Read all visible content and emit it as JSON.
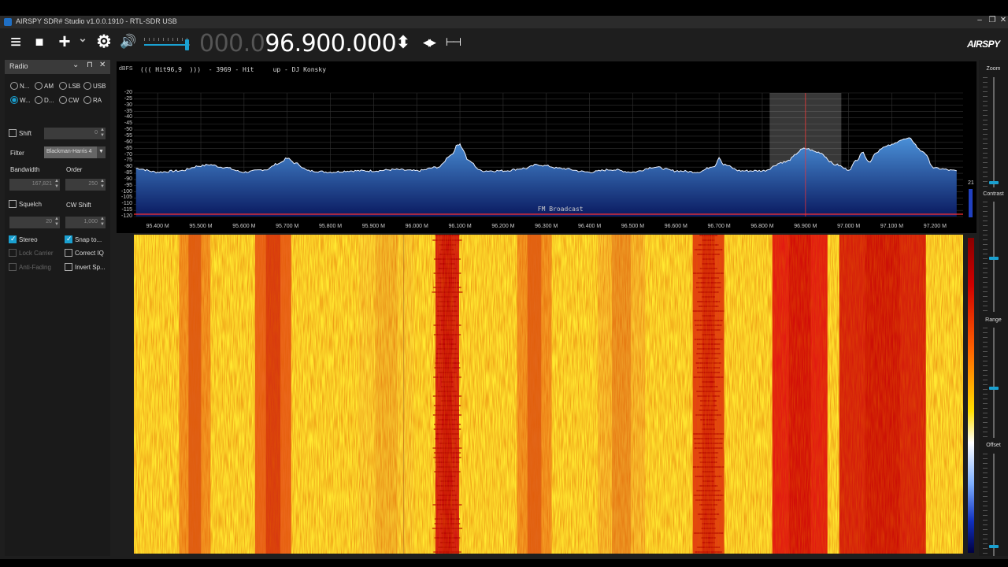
{
  "window": {
    "title": "AIRSPY SDR# Studio v1.0.0.1910 - RTL-SDR USB",
    "minimize": "–",
    "maximize": "❐",
    "close": "✕"
  },
  "toolbar": {
    "menu_icon": "≡",
    "stop_icon": "■",
    "add_icon": "+",
    "add_dropdown": "⌄",
    "settings_icon": "⚙",
    "volume_icon": "🔊",
    "volume_level": 0.93,
    "freq_dim": "000.0",
    "freq_main": "96.900.000",
    "step_updown": "⬍",
    "step_leftright": "◀▶",
    "span_icon": "⊢⊣",
    "logo": "AIRSPY"
  },
  "radio_panel": {
    "title": "Radio",
    "dropdown": "⌄",
    "pin": "⊓",
    "close": "✕",
    "modes": [
      {
        "label": "N...",
        "selected": false
      },
      {
        "label": "AM",
        "selected": false
      },
      {
        "label": "LSB",
        "selected": false
      },
      {
        "label": "USB",
        "selected": false
      },
      {
        "label": "W...",
        "selected": true
      },
      {
        "label": "D...",
        "selected": false
      },
      {
        "label": "CW",
        "selected": false
      },
      {
        "label": "RA",
        "selected": false
      }
    ],
    "shift_label": "Shift",
    "shift_value": "0",
    "filter_label": "Filter",
    "filter_value": "Blackman-Harris 4",
    "bandwidth_label": "Bandwidth",
    "bandwidth_value": "167,821",
    "order_label": "Order",
    "order_value": "250",
    "squelch_label": "Squelch",
    "squelch_value": "20",
    "cwshift_label": "CW Shift",
    "cwshift_value": "1,000",
    "stereo_label": "Stereo",
    "snap_label": "Snap to...",
    "lock_carrier_label": "Lock Carrier",
    "correct_iq_label": "Correct IQ",
    "anti_fading_label": "Anti-Fading",
    "invert_spectrum_label": "Invert Sp..."
  },
  "spectrum": {
    "dbfs_label": "dBFS",
    "station_text": "((( Hit96,9  )))  - 3969 - Hit     up - DJ Konsky",
    "band_label": "FM Broadcast",
    "signal_value": "21",
    "colors": {
      "fill_top": "#4a90d8",
      "fill_bottom": "#0a1a60",
      "trace": "#e8f0ff",
      "vfo": "#ff3030",
      "band": "#ff3030"
    }
  },
  "zoom_panel": {
    "zoom_label": "Zoom",
    "contrast_label": "Contrast",
    "range_label": "Range",
    "offset_label": "Offset"
  },
  "chart_data": {
    "type": "area",
    "ylabel": "dBFS",
    "y_ticks": [
      "-20",
      "-25",
      "-30",
      "-35",
      "-40",
      "-45",
      "-50",
      "-55",
      "-60",
      "-65",
      "-70",
      "-75",
      "-80",
      "-85",
      "-90",
      "-95",
      "-100",
      "-105",
      "-110",
      "-115",
      "-120"
    ],
    "ylim": [
      -120,
      -20
    ],
    "x_ticks": [
      "95.400 M",
      "95.500 M",
      "95.600 M",
      "95.700 M",
      "95.800 M",
      "95.900 M",
      "96.000 M",
      "96.100 M",
      "96.200 M",
      "96.300 M",
      "96.400 M",
      "96.500 M",
      "96.600 M",
      "96.700 M",
      "96.800 M",
      "96.900 M",
      "97.000 M",
      "97.100 M",
      "97.200 M"
    ],
    "xlim": [
      95.345,
      97.265
    ],
    "x": [
      95.35,
      95.4,
      95.45,
      95.5,
      95.52,
      95.55,
      95.6,
      95.65,
      95.68,
      95.7,
      95.72,
      95.75,
      95.8,
      95.85,
      95.9,
      95.95,
      96.0,
      96.05,
      96.08,
      96.095,
      96.1,
      96.105,
      96.12,
      96.15,
      96.2,
      96.25,
      96.28,
      96.3,
      96.33,
      96.4,
      96.45,
      96.5,
      96.55,
      96.6,
      96.65,
      96.69,
      96.7,
      96.71,
      96.75,
      96.8,
      96.85,
      96.9,
      96.93,
      96.97,
      97.0,
      97.02,
      97.03,
      97.05,
      97.06,
      97.08,
      97.1,
      97.12,
      97.14,
      97.17,
      97.2,
      97.25
    ],
    "y": [
      -81,
      -84,
      -83,
      -79,
      -78,
      -80,
      -84,
      -82,
      -77,
      -73,
      -77,
      -83,
      -84,
      -83,
      -83,
      -82,
      -83,
      -80,
      -70,
      -62,
      -61,
      -65,
      -75,
      -83,
      -83,
      -81,
      -78,
      -79,
      -81,
      -84,
      -82,
      -84,
      -80,
      -83,
      -84,
      -79,
      -72,
      -78,
      -83,
      -83,
      -76,
      -65,
      -68,
      -78,
      -82,
      -74,
      -68,
      -76,
      -69,
      -64,
      -62,
      -58,
      -57,
      -67,
      -81,
      -83
    ],
    "vfo_center": 96.9,
    "passband": [
      96.817,
      96.983
    ]
  }
}
